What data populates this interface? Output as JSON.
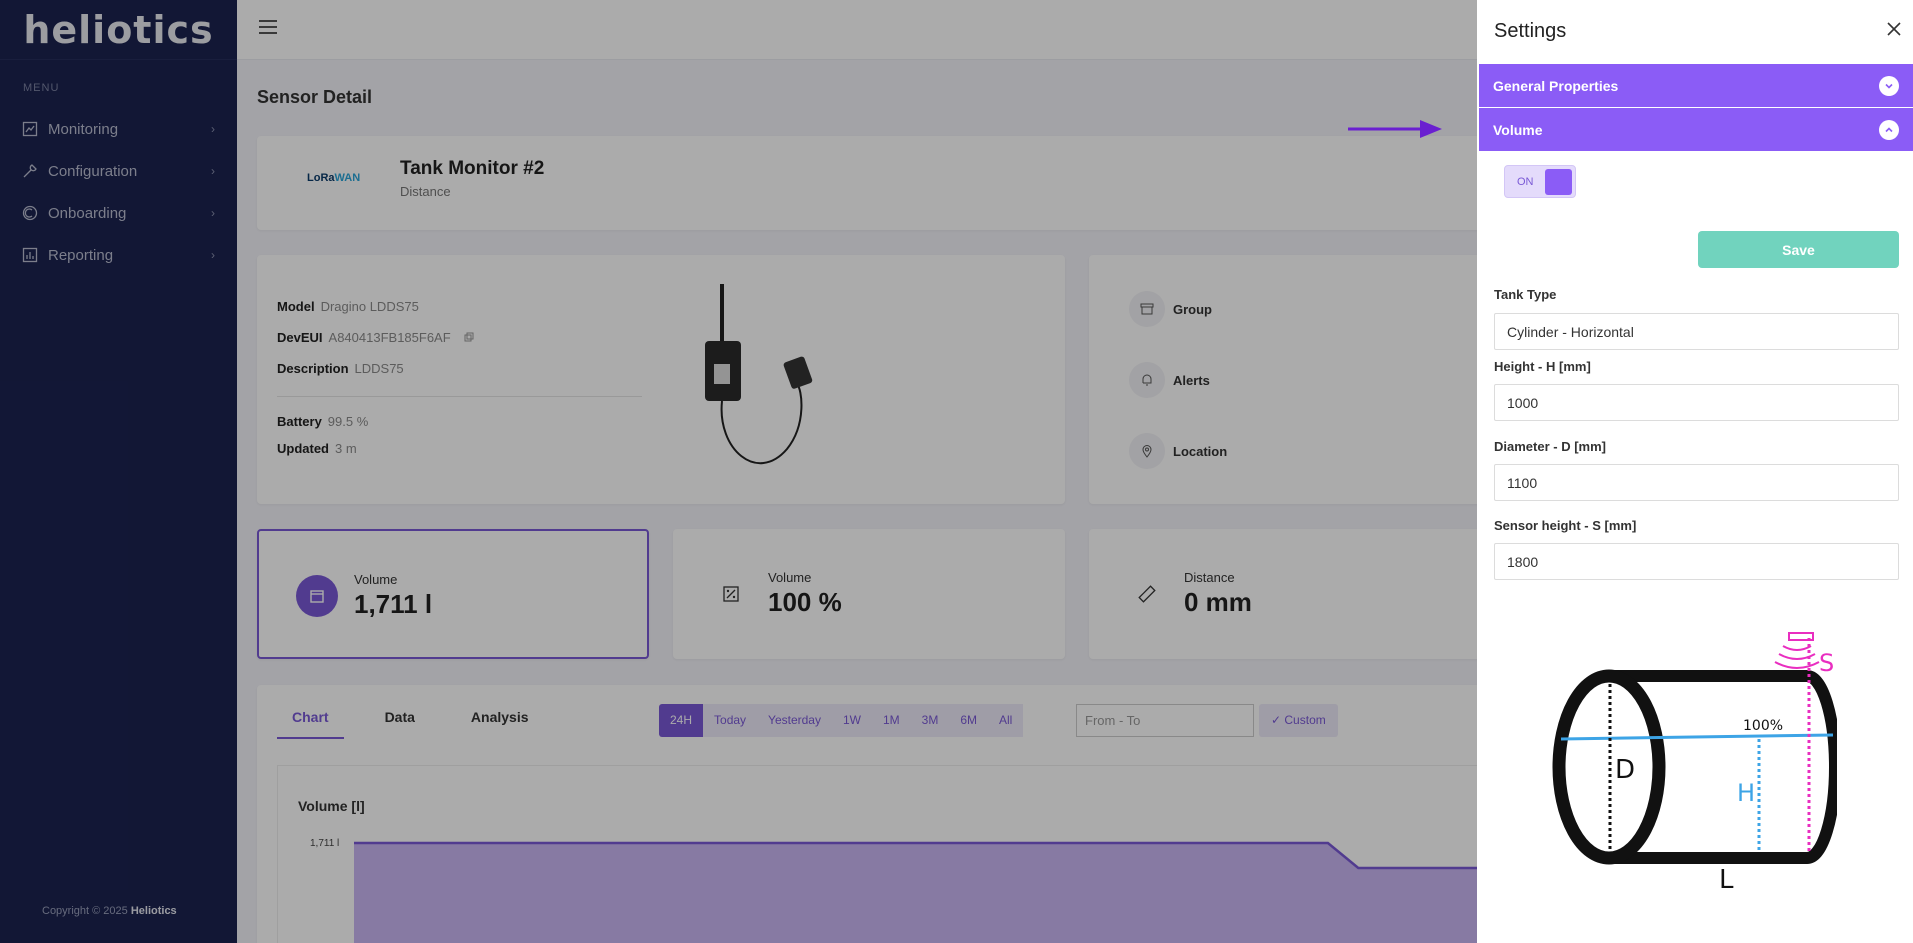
{
  "brand": {
    "logo_text": "heliotics"
  },
  "sidebar": {
    "menu_title": "MENU",
    "items": [
      {
        "label": "Monitoring",
        "icon": "chart-icon"
      },
      {
        "label": "Configuration",
        "icon": "wrench-icon"
      },
      {
        "label": "Onboarding",
        "icon": "onboarding-icon"
      },
      {
        "label": "Reporting",
        "icon": "report-icon"
      }
    ],
    "copyright_prefix": "Copyright © 2025",
    "copyright_brand": "Heliotics"
  },
  "page": {
    "title": "Sensor Detail"
  },
  "sensor": {
    "logo_text_a": "LoRa",
    "logo_text_b": "WAN",
    "name": "Tank Monitor #2",
    "type": "Distance",
    "model_label": "Model",
    "model": "Dragino LDDS75",
    "deveui_label": "DevEUI",
    "deveui": "A840413FB185F6AF",
    "description_label": "Description",
    "description": "LDDS75",
    "battery_label": "Battery",
    "battery": "99.5 %",
    "updated_label": "Updated",
    "updated": "3 m"
  },
  "properties": {
    "group": "Group",
    "alerts": "Alerts",
    "location": "Location"
  },
  "stats": [
    {
      "label": "Volume",
      "value": "1,711 l"
    },
    {
      "label": "Volume",
      "value": "100 %"
    },
    {
      "label": "Distance",
      "value": "0 mm"
    }
  ],
  "chart_section": {
    "tabs": [
      "Chart",
      "Data",
      "Analysis"
    ],
    "ranges": [
      "24H",
      "Today",
      "Yesterday",
      "1W",
      "1M",
      "3M",
      "6M",
      "All"
    ],
    "from_to_placeholder": "From - To",
    "custom_label": "✓ Custom",
    "chart_title": "Volume [l]",
    "y_tick": "1,711 l"
  },
  "chart_data": {
    "type": "area",
    "title": "Volume [l]",
    "ylabel": "",
    "series": [
      {
        "values": [
          1711,
          1711,
          1711,
          1711,
          1711,
          1711,
          1711,
          1711,
          1711,
          1711,
          1711,
          1711,
          1711,
          1711,
          1711,
          1711,
          1711,
          1711,
          1711,
          1711,
          1711,
          1711,
          1711,
          1711,
          1711,
          1711,
          1711,
          1711,
          1711,
          1711,
          1711,
          1711,
          1711,
          1650,
          1650,
          1650,
          1650,
          1650,
          1650,
          1650,
          1650,
          1650,
          1650,
          1650,
          1650,
          1650,
          1650
        ]
      }
    ]
  },
  "settings": {
    "title": "Settings",
    "general_label": "General Properties",
    "volume_label": "Volume",
    "toggle_label": "ON",
    "save_label": "Save",
    "tank_type_label": "Tank Type",
    "tank_type": "Cylinder - Horizontal",
    "height_label": "Height - H [mm]",
    "height": "1000",
    "diameter_label": "Diameter - D [mm]",
    "diameter": "1100",
    "sensor_height_label": "Sensor height - S [mm]",
    "sensor_height": "1800"
  },
  "diagram": {
    "d": "D",
    "h": "H",
    "l": "L",
    "s": "S",
    "pct": "100%"
  },
  "colors": {
    "accent": "#8b5cf6",
    "save": "#71d3be",
    "sidebar": "#1b2350"
  }
}
